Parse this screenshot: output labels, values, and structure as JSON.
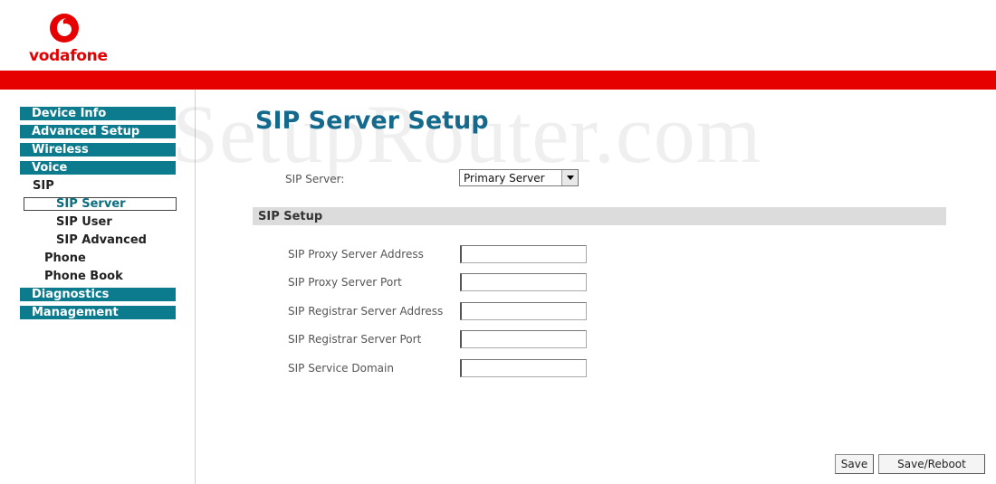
{
  "brand": {
    "logo_text": "vodafone",
    "accent": "#e60000",
    "menu_color": "#0b7b8d"
  },
  "watermark": "SetupRouter.com",
  "sidebar": {
    "device_info": "Device Info",
    "advanced_setup": "Advanced Setup",
    "wireless": "Wireless",
    "voice": "Voice",
    "sip": "SIP",
    "sip_server": "SIP Server",
    "sip_user": "SIP User",
    "sip_advanced": "SIP Advanced",
    "phone": "Phone",
    "phone_book": "Phone Book",
    "diagnostics": "Diagnostics",
    "management": "Management"
  },
  "main": {
    "title": "SIP Server Setup",
    "sip_server_label": "SIP Server:",
    "sip_server_value": "Primary Server",
    "section_title": "SIP Setup",
    "fields": {
      "proxy_address": {
        "label": "SIP Proxy Server Address",
        "value": ""
      },
      "proxy_port": {
        "label": "SIP Proxy Server Port",
        "value": ""
      },
      "registrar_address": {
        "label": "SIP Registrar Server Address",
        "value": ""
      },
      "registrar_port": {
        "label": "SIP Registrar Server Port",
        "value": ""
      },
      "service_domain": {
        "label": "SIP Service Domain",
        "value": ""
      }
    }
  },
  "buttons": {
    "save": "Save",
    "save_reboot": "Save/Reboot"
  }
}
